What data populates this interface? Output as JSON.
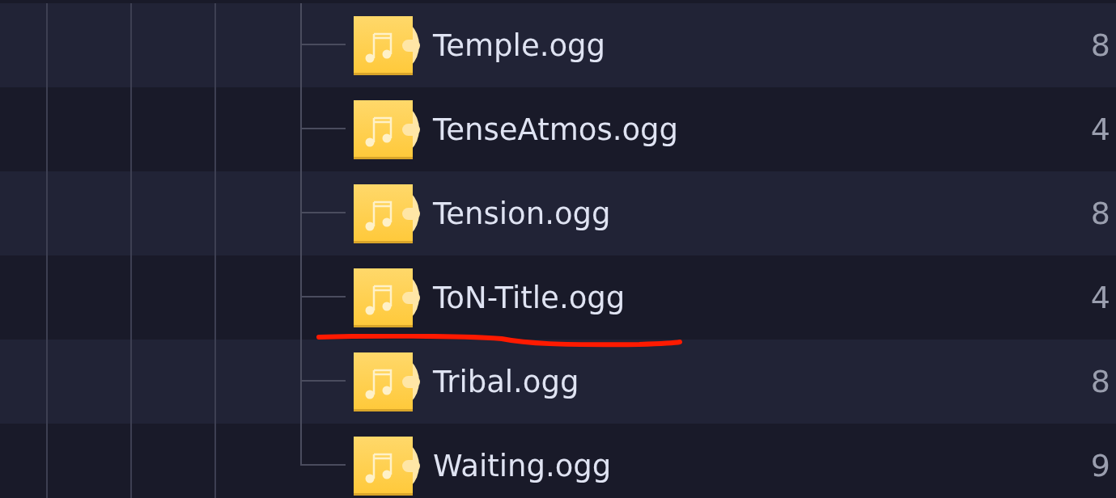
{
  "files": [
    {
      "name": "Temple.ogg",
      "column_2": "8",
      "underlined": false
    },
    {
      "name": "TenseAtmos.ogg",
      "column_2": "4",
      "underlined": false
    },
    {
      "name": "Tension.ogg",
      "column_2": "8",
      "underlined": false
    },
    {
      "name": "ToN-Title.ogg",
      "column_2": "4",
      "underlined": true
    },
    {
      "name": "Tribal.ogg",
      "column_2": "8",
      "underlined": false
    },
    {
      "name": "Waiting.ogg",
      "column_2": "9",
      "underlined": false
    }
  ]
}
